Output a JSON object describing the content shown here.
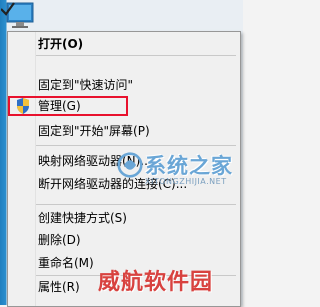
{
  "menu": {
    "items": [
      {
        "label": "打开(O)",
        "bold": true
      },
      {
        "label": "固定到\"快速访问\""
      },
      {
        "label": "管理(G)",
        "icon": "shield-icon"
      },
      {
        "label": "固定到\"开始\"屏幕(P)"
      },
      {
        "label": "映射网络驱动器(N)..."
      },
      {
        "label": "断开网络驱动器的连接(C)..."
      },
      {
        "label": "创建快捷方式(S)"
      },
      {
        "label": "删除(D)"
      },
      {
        "label": "重命名(M)"
      },
      {
        "label": "属性(R)"
      }
    ]
  },
  "watermarks": {
    "site1_name": "系统之家",
    "site1_url": "XITONGZHIJIA.NET",
    "site2_name": "威航软件园"
  },
  "colors": {
    "highlight": "#e8112d",
    "watermark1": "#6aa6d6",
    "watermark2": "#d8423f"
  }
}
